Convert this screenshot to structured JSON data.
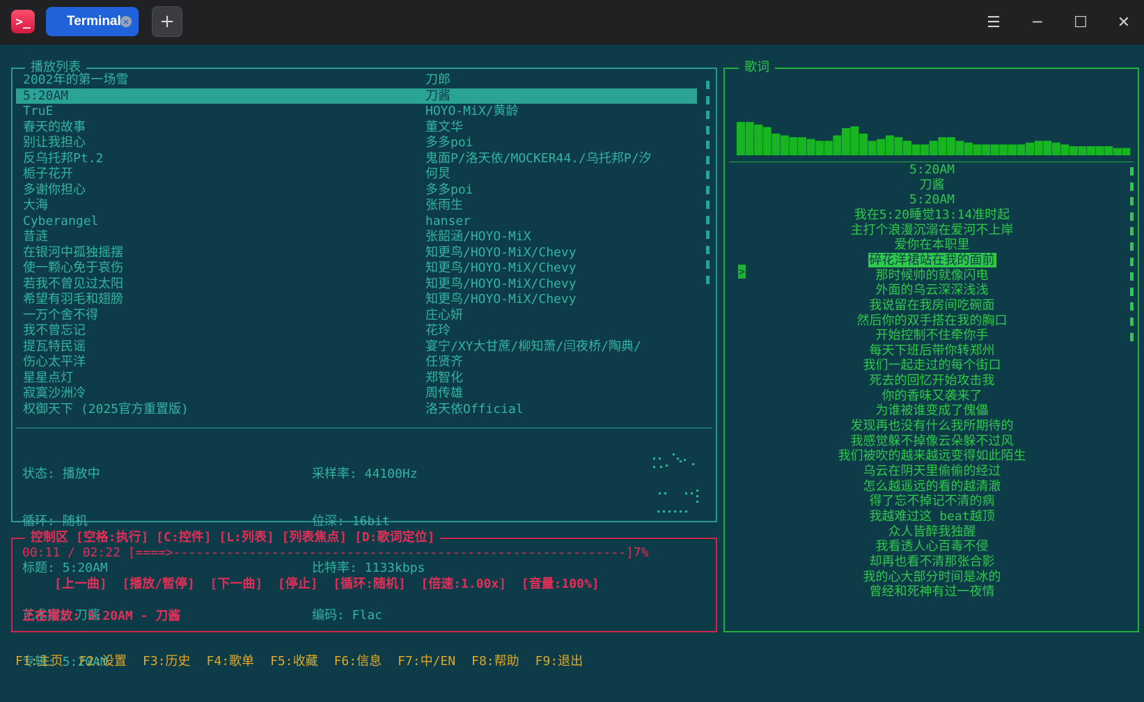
{
  "window": {
    "tab_label": "Terminal",
    "tab_close_glyph": "×",
    "new_tab_glyph": "+",
    "app_icon_glyph": ">_",
    "menu_glyph": "☰",
    "minimize_glyph": "─",
    "maximize_glyph": "☐",
    "close_glyph": "✕"
  },
  "playlist": {
    "title": "播放列表",
    "selected_index": 1,
    "songs": [
      {
        "title": "2002年的第一场雪",
        "artist": "刀郎"
      },
      {
        "title": "5:20AM",
        "artist": "刀酱"
      },
      {
        "title": "TruE",
        "artist": "HOYO-MiX/黄龄"
      },
      {
        "title": "春天的故事",
        "artist": "董文华"
      },
      {
        "title": "别让我担心",
        "artist": "多多poi"
      },
      {
        "title": "反乌托邦Pt.2",
        "artist": "鬼面P/洛天依/MOCKER44./乌托邦P/汐"
      },
      {
        "title": "栀子花开",
        "artist": "何炅"
      },
      {
        "title": "多谢你担心",
        "artist": "多多poi"
      },
      {
        "title": "大海",
        "artist": "张雨生"
      },
      {
        "title": "Cyberangel",
        "artist": "hanser"
      },
      {
        "title": "昔涟",
        "artist": "张韶涵/HOYO-MiX"
      },
      {
        "title": "在银河中孤独摇摆",
        "artist": "知更鸟/HOYO-MiX/Chevy"
      },
      {
        "title": "使一颗心免于哀伤",
        "artist": "知更鸟/HOYO-MiX/Chevy"
      },
      {
        "title": "若我不曾见过太阳",
        "artist": "知更鸟/HOYO-MiX/Chevy"
      },
      {
        "title": "希望有羽毛和翅膀",
        "artist": "知更鸟/HOYO-MiX/Chevy"
      },
      {
        "title": "一万个舍不得",
        "artist": "庄心妍"
      },
      {
        "title": "我不曾忘记",
        "artist": "花玲"
      },
      {
        "title": "提瓦特民谣",
        "artist": "宴宁/XY大甘蔗/柳知萧/闫夜桥/陶典/"
      },
      {
        "title": "伤心太平洋",
        "artist": "任贤齐"
      },
      {
        "title": "星星点灯",
        "artist": "郑智化"
      },
      {
        "title": "寂寞沙洲冷",
        "artist": "周传雄"
      },
      {
        "title": "权御天下 (2025官方重置版)",
        "artist": "洛天依Official"
      }
    ],
    "info_left": [
      "状态: 播放中",
      "循环: 随机",
      "标题: 5:20AM",
      "艺术家: 刀酱",
      "专辑: 5:20AM"
    ],
    "info_right": [
      "采样率: 44100Hz",
      "位深: 16bit",
      "比特率: 1133kbps",
      "编码: Flac"
    ]
  },
  "controls": {
    "title": "控制区 [空格:执行] [C:控件] [L:列表] [列表焦点] [D:歌词定位]",
    "progress_line": "00:11 / 02:22 [====>------------------------------------------------------------]7%",
    "progress_percent": 7,
    "buttons_line": "[上一曲]  [播放/暂停]  [下一曲]  [停止]  [循环:随机]  [倍速:1.00x]  [音量:100%]",
    "now_playing": "正在播放: 5:20AM - 刀酱"
  },
  "lyrics": {
    "title": "歌词",
    "current_index": 6,
    "cursor_glyph": ">",
    "lines": [
      "5:20AM",
      "刀酱",
      "5:20AM",
      "我在5:20睡觉13:14准时起",
      "主打个浪漫沉溺在爱河不上岸",
      "爱你在本职里",
      "碎花洋裙站在我的面前",
      "那时候帅的就像闪电",
      "外面的乌云深深浅浅",
      "我说留在我房间吃碗面",
      "然后你的双手搭在我的胸口",
      "开始控制不住牵你手",
      "每天下班后带你转郑州",
      "我们一起走过的每个街口",
      "死去的回忆开始攻击我",
      "你的香味又袭来了",
      "为谁被谁变成了傀儡",
      "发现再也没有什么我所期待的",
      "我感觉躲不掉像云朵躲不过风",
      "我们被吹的越来越远变得如此陌生",
      "乌云在阴天里偷偷的经过",
      "怎么越遥远的看的越清澈",
      "得了忘不掉记不清的病",
      "我越难过这 beat越顶",
      "众人皆醉我独醒",
      "我看透人心百毒不侵",
      "却再也看不清那张合影",
      "我的心大部分时间是冰的",
      "曾经和死神有过一夜情"
    ],
    "spectrum_levels": [
      0.92,
      0.92,
      0.85,
      0.78,
      0.6,
      0.55,
      0.5,
      0.5,
      0.45,
      0.4,
      0.4,
      0.55,
      0.75,
      0.8,
      0.6,
      0.4,
      0.45,
      0.55,
      0.5,
      0.4,
      0.3,
      0.3,
      0.4,
      0.5,
      0.5,
      0.4,
      0.35,
      0.3,
      0.3,
      0.3,
      0.3,
      0.3,
      0.3,
      0.35,
      0.4,
      0.4,
      0.35,
      0.3,
      0.25,
      0.25,
      0.25,
      0.25,
      0.25,
      0.2,
      0.2
    ]
  },
  "function_keys": [
    "F1:主页",
    "F2:设置",
    "F3:历史",
    "F4:歌单",
    "F5:收藏",
    "F6:信息",
    "F7:中/EN",
    "F8:帮助",
    "F9:退出"
  ],
  "colors": {
    "background": "#0d3c48",
    "playlist_accent": "#2fb3a3",
    "control_accent": "#e62d58",
    "lyrics_accent": "#2ec84a",
    "fkey_accent": "#e2a825",
    "tab_blue": "#1f62d9"
  }
}
